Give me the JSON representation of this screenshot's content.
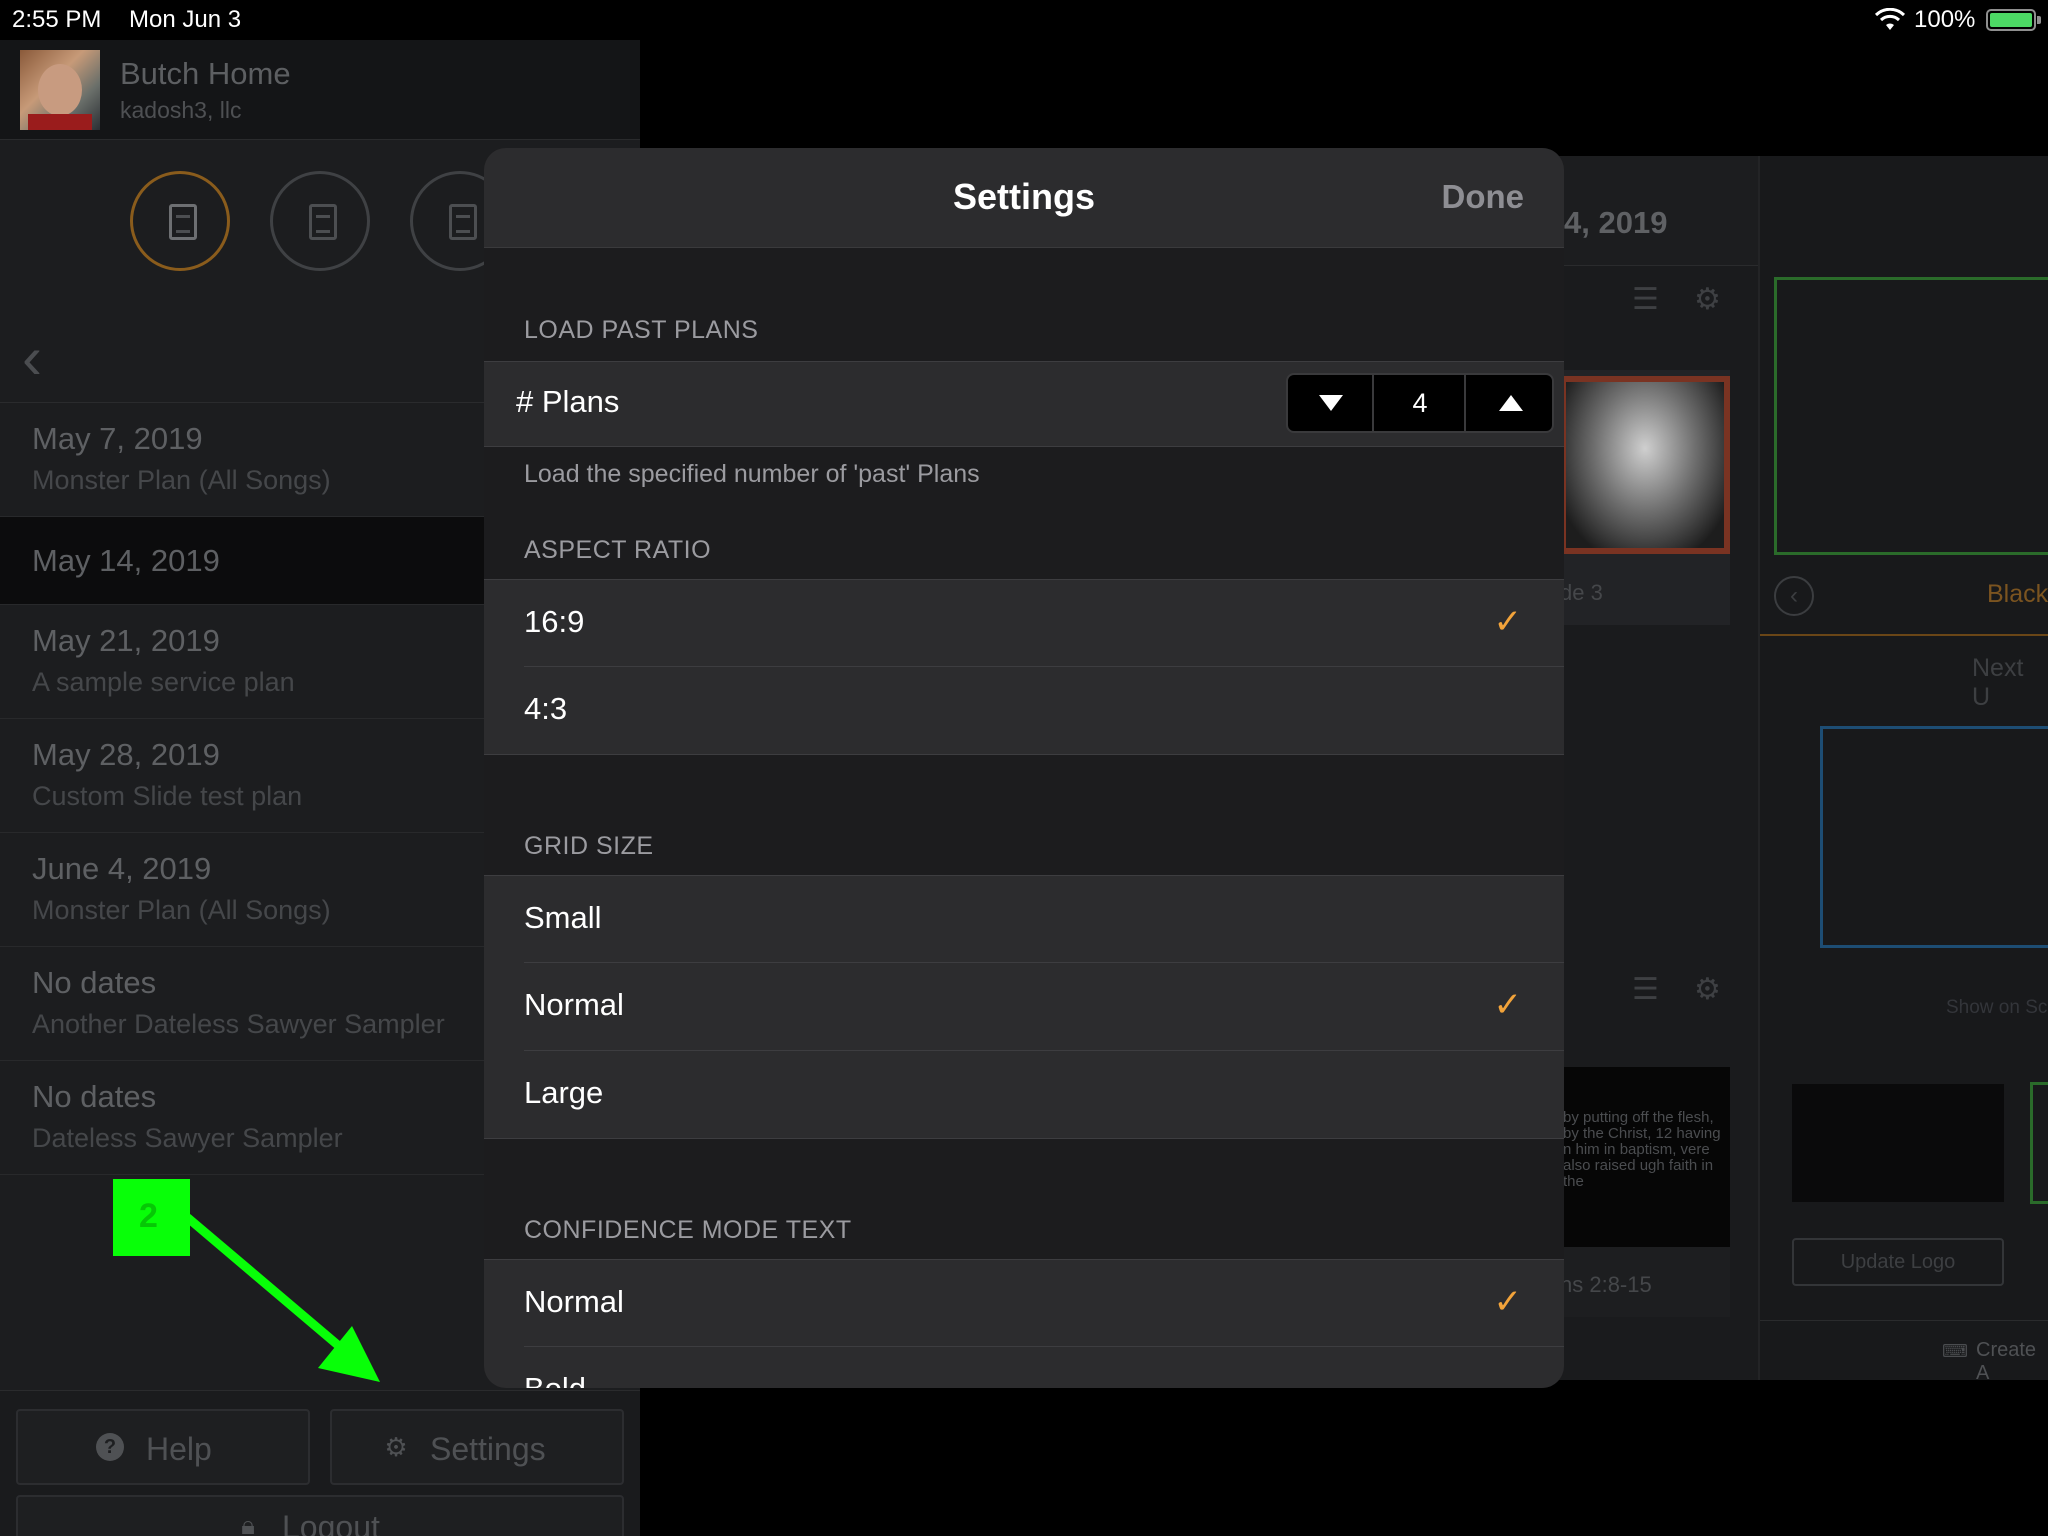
{
  "status_bar": {
    "time": "2:55 PM",
    "date": "Mon Jun 3",
    "battery_pct": "100%"
  },
  "profile": {
    "name": "Butch Home",
    "org": "kadosh3, llc"
  },
  "plans": [
    {
      "date": "May 7, 2019",
      "name": "Monster Plan (All Songs)"
    },
    {
      "date": "May 14, 2019",
      "name": ""
    },
    {
      "date": "May 21, 2019",
      "name": "A sample service plan"
    },
    {
      "date": "May 28, 2019",
      "name": "Custom Slide test plan"
    },
    {
      "date": "June 4, 2019",
      "name": "Monster Plan (All Songs)"
    },
    {
      "date": "No dates",
      "name": "Another Dateless Sawyer Sampler"
    },
    {
      "date": "No dates",
      "name": "Dateless Sawyer Sampler"
    }
  ],
  "sidebar_footer": {
    "help_label": "Help",
    "settings_label": "Settings",
    "logout_label": "Logout"
  },
  "annotation": {
    "step": "2",
    "color": "#08ff08"
  },
  "background": {
    "detail_date": "4, 2019",
    "slide_label": "de 3",
    "verse_text": "by putting off the flesh, by the Christ, 12 having n him in baptism, vere also raised ugh faith in the",
    "verse_label": "ns 2:8-15",
    "black_label": "Black",
    "next_up_label": "Next U",
    "show_on_label": "Show on Sc",
    "update_logo_label": "Update Logo",
    "create_label": "Create A"
  },
  "modal": {
    "title": "Settings",
    "done_label": "Done",
    "accent_color": "#f2a33a",
    "load_past_plans": {
      "header": "LOAD PAST PLANS",
      "row_label": "# Plans",
      "stepper_value": "4",
      "footnote": "Load the specified number of 'past' Plans"
    },
    "aspect_ratio": {
      "header": "ASPECT RATIO",
      "options": [
        {
          "label": "16:9",
          "selected": true
        },
        {
          "label": "4:3",
          "selected": false
        }
      ]
    },
    "grid_size": {
      "header": "GRID SIZE",
      "options": [
        {
          "label": "Small",
          "selected": false
        },
        {
          "label": "Normal",
          "selected": true
        },
        {
          "label": "Large",
          "selected": false
        }
      ]
    },
    "confidence_mode_text": {
      "header": "CONFIDENCE MODE TEXT",
      "options": [
        {
          "label": "Normal",
          "selected": true
        },
        {
          "label": "Bold",
          "selected": false
        }
      ]
    },
    "check_glyph": "✓"
  }
}
